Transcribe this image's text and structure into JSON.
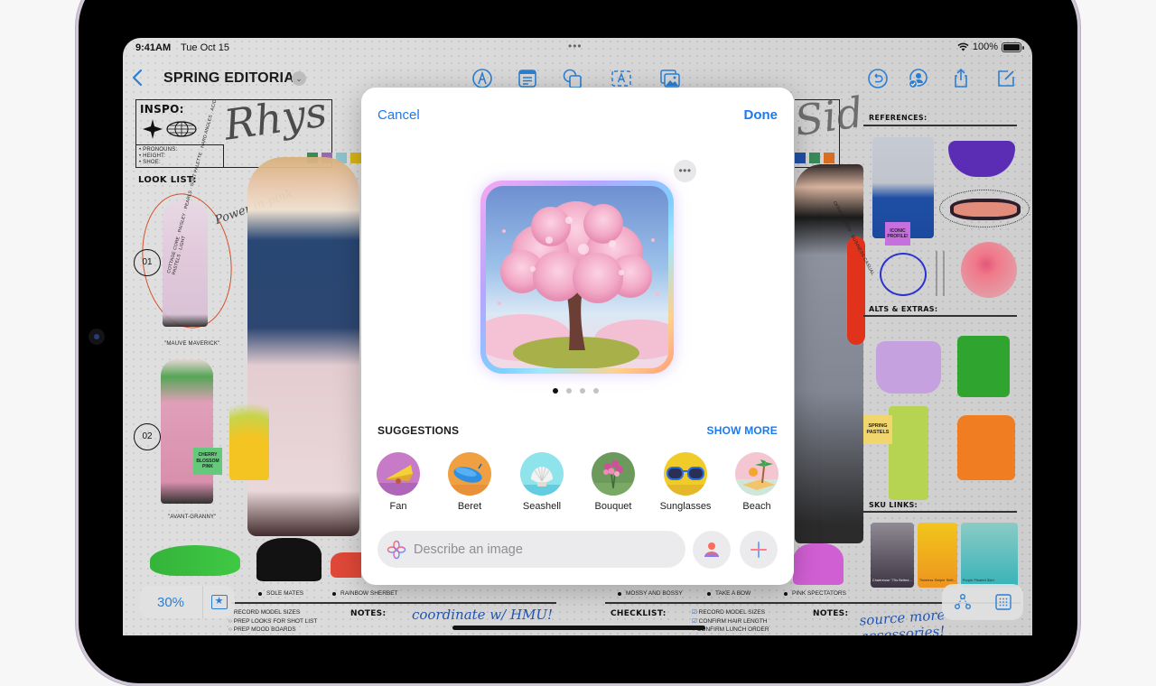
{
  "status_bar": {
    "time": "9:41AM",
    "date": "Tue Oct 15",
    "battery": "100%",
    "battery_level": 1.0
  },
  "toolbar": {
    "title": "SPRING EDITORIAL",
    "icons": [
      "back-icon",
      "pen-tool-icon",
      "note-icon",
      "shapes-icon",
      "text-box-icon",
      "media-icon",
      "undo-icon",
      "collaborate-icon",
      "share-icon",
      "compose-icon"
    ]
  },
  "board": {
    "inspo_heading": "INSPO:",
    "inspo_fields": [
      "• PRONOUNS:",
      "• HEIGHT:",
      "• SHOE:"
    ],
    "signature_left": "Rhys",
    "signature_right": "Sid",
    "look_list_heading": "LOOK LIST:",
    "look_numbers": [
      "01",
      "02"
    ],
    "look_names": [
      "\"MAUVE MAVERICK\"",
      "\"AVANT-GRANNY\""
    ],
    "sticky_cherry": "CHERRY BLOSSOM PINK",
    "power_in_pink": "Power in pink",
    "tags_left": "COTTAGE CORE · PAISLEY · PEARLS · SOFT PALETTE · HARD ANGLES · ACID PASTELS · LIGHT",
    "tags_right": "OFFICE SIREN · BUSINESS CASUAL",
    "references_heading": "REFERENCES:",
    "sticky_iconic": "ICONIC PROFILE!",
    "alts_heading": "ALTS & EXTRAS:",
    "sticky_spring": "SPRING PASTELS",
    "sku_heading": "SKU LINKS:",
    "sku_items": [
      "Chartreuse \"70s Belted...",
      "Timeless Simple Shift...",
      "Purple Pleated Skirt"
    ],
    "shoe_labels_left": [
      "SOLE MATES",
      "RAINBOW SHERBET"
    ],
    "shoe_labels_right": [
      "MOSSY AND BOSSY",
      "TAKE A BOW",
      "PINK SPECTATORS"
    ],
    "notes_heading": "NOTES:",
    "checklist_heading": "CHECKLIST:",
    "checklist_left": [
      {
        "label": "RECORD MODEL SIZES",
        "checked": false
      },
      {
        "label": "PREP LOOKS FOR SHOT LIST",
        "checked": false
      },
      {
        "label": "PREP MOOD BOARDS",
        "checked": false
      }
    ],
    "checklist_right": [
      {
        "label": "RECORD MODEL SIZES",
        "checked": true
      },
      {
        "label": "CONFIRM HAIR LENGTH",
        "checked": true
      },
      {
        "label": "CONFIRM LUNCH ORDER",
        "checked": false
      }
    ],
    "note_left": "coordinate w/ HMU!",
    "note_right": "source more accessories!",
    "swatches_left": [
      "#3a8a5a",
      "#9a68b0",
      "#8ec2cc",
      "#d6b418"
    ],
    "swatches_right": [
      "#1f4fa8",
      "#3a8a5a",
      "#d86e22"
    ]
  },
  "zoom_control": {
    "value": "30%"
  },
  "dialog": {
    "cancel_label": "Cancel",
    "done_label": "Done",
    "preview_alt": "Cherry blossom tree",
    "page_count": 4,
    "active_page": 1,
    "suggestions_heading": "SUGGESTIONS",
    "show_more_label": "SHOW MORE",
    "suggestions": [
      {
        "label": "Fan",
        "bg": "#c77bc7"
      },
      {
        "label": "Beret",
        "bg": "#f0a040"
      },
      {
        "label": "Seashell",
        "bg": "#8fe3ea"
      },
      {
        "label": "Bouquet",
        "bg": "#6c9a5c"
      },
      {
        "label": "Sunglasses",
        "bg": "#f0cc2a"
      },
      {
        "label": "Beach",
        "bg": "#f4c6d2"
      }
    ],
    "prompt_placeholder": "Describe an image",
    "prompt_value": ""
  },
  "colors": {
    "accent": "#1a7af0",
    "toolbar_accent": "#2a7fd4"
  }
}
